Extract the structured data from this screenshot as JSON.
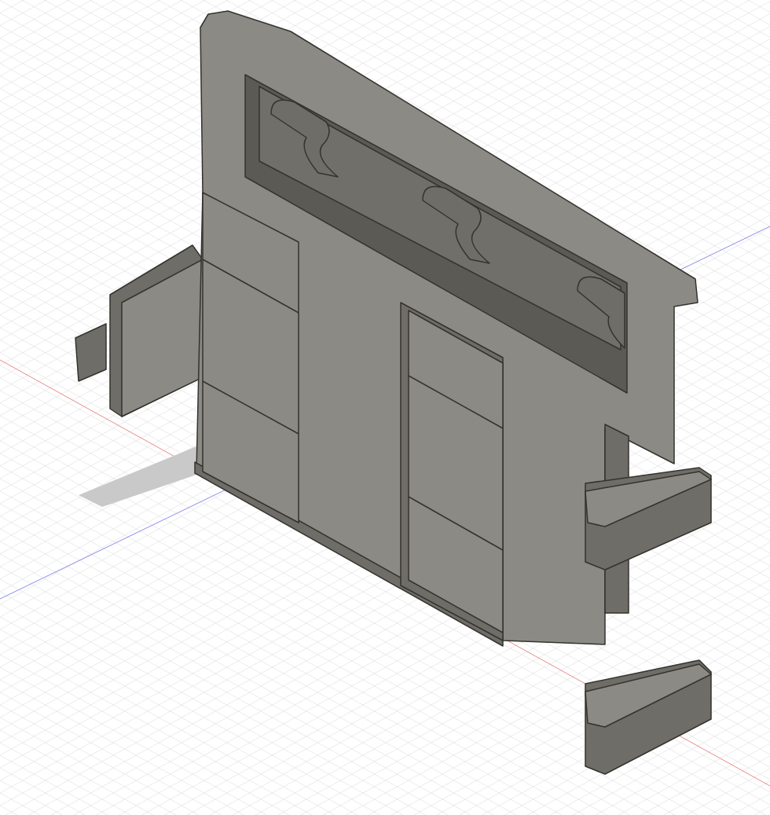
{
  "viewport": {
    "axes": [
      {
        "kind": "x",
        "color": "#e88a8a"
      },
      {
        "kind": "z",
        "color": "#8c8ce8"
      }
    ]
  }
}
